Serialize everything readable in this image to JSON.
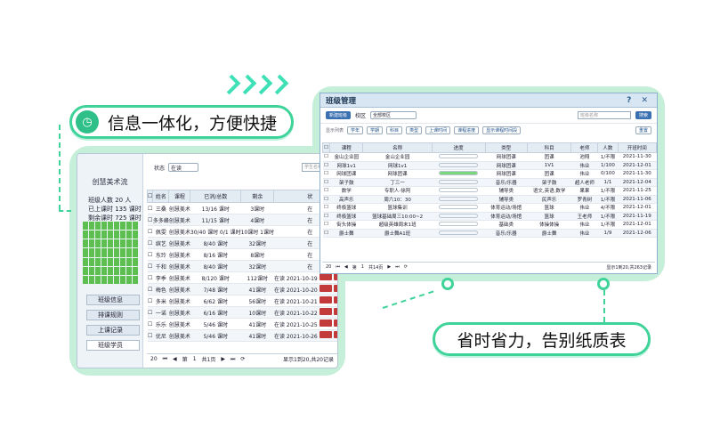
{
  "callouts": {
    "top": "信息一体化，方便快捷",
    "bottom": "省时省力，告别纸质表"
  },
  "colors": {
    "accent": "#3fd39a",
    "frame": "#c6efd9",
    "progress": "#79d77c"
  },
  "back_window": {
    "school": "创慧美术流",
    "stats": [
      "班级人数  20 人",
      "已上课时   135 课时",
      "剩余课时   725 课时"
    ],
    "menu": [
      "班级信息",
      "排课规则",
      "上课记录",
      "班级学员"
    ],
    "filter_label": "状态",
    "filter_value": "在读",
    "search_placeholder": "学生名称",
    "columns": [
      "姓名",
      "课程",
      "已消/总数",
      "剩余",
      "状"
    ],
    "rows": [
      {
        "name": "三桑",
        "course": "创慧美术",
        "used": "13/16 课时",
        "left": "3课时",
        "status": "在"
      },
      {
        "name": "多多峰",
        "course": "创慧美术",
        "used": "11/15 课时",
        "left": "4课时",
        "status": "在"
      },
      {
        "name": "佩雯",
        "course": "创慧美术",
        "used": "30/40 课时 0/1 课时",
        "left": "10课时 1课时",
        "status": "在"
      },
      {
        "name": "缤艺",
        "course": "创慧美术",
        "used": "8/40 课时",
        "left": "32课时",
        "status": "在"
      },
      {
        "name": "东玲",
        "course": "创慧美术",
        "used": "8/16 课时",
        "left": "8课时",
        "status": "在"
      },
      {
        "name": "千和",
        "course": "创慧美术",
        "used": "8/40 课时",
        "left": "32课时",
        "status": "在"
      },
      {
        "name": "李季",
        "course": "创慧美术",
        "used": "8/120 课时",
        "left": "112课时",
        "status": "在读",
        "date": "2021-10-19"
      },
      {
        "name": "梅色",
        "course": "创慧美术",
        "used": "7/48 课时",
        "left": "41课时",
        "status": "在读",
        "date": "2021-10-20"
      },
      {
        "name": "多米",
        "course": "创慧美术",
        "used": "6/62 课时",
        "left": "56课时",
        "status": "在读",
        "date": "2021-10-21"
      },
      {
        "name": "一诺",
        "course": "创慧美术",
        "used": "6/16 课时",
        "left": "10课时",
        "status": "在读",
        "date": "2021-10-22"
      },
      {
        "name": "乐乐",
        "course": "创慧美术",
        "used": "5/46 课时",
        "left": "41课时",
        "status": "在读",
        "date": "2021-10-25"
      },
      {
        "name": "优尼",
        "course": "创慧美术",
        "used": "5/46 课时",
        "left": "41课时",
        "status": "在读",
        "date": "2021-10-26"
      }
    ],
    "pager": {
      "size": "20",
      "page_label": "第",
      "page": "1",
      "total": "共1页",
      "summary": "显示1到20,共20记录"
    }
  },
  "front_window": {
    "title": "班级管理",
    "controls": "? ✕",
    "new_btn": "新建班级",
    "campus_label": "校区",
    "campus_value": "全部校区",
    "search_placeholder": "班级名称",
    "search_btn": "搜索",
    "tags_label": "显示列表",
    "tags": [
      "学年",
      "学期",
      "科目",
      "类型",
      "上课时间",
      "课程进度",
      "显示课程时间段"
    ],
    "reset": "重置",
    "columns": [
      "课程",
      "名称",
      "进度",
      "类型",
      "科目",
      "老师",
      "人数",
      "开班时间"
    ],
    "rows": [
      {
        "course": "金山企业园",
        "name": "金山企业园",
        "progress": 0,
        "type": "网球团课",
        "subject": "团课",
        "teacher": "池翔",
        "count": "1/不限",
        "date": "2021-11-30"
      },
      {
        "course": "网球1v1",
        "name": "网球1v1",
        "progress": 0,
        "type": "网球团课",
        "subject": "1V1",
        "teacher": "伟业",
        "count": "1/100",
        "date": "2021-12-01"
      },
      {
        "course": "网球团课",
        "name": "网球团课",
        "progress": 100,
        "type": "网球团课",
        "subject": "团课",
        "teacher": "伟业",
        "count": "0/100",
        "date": "2021-11-30"
      },
      {
        "course": "架子鼓",
        "name": "丁三一",
        "progress": 0,
        "type": "音乐/乐器",
        "subject": "架子鼓",
        "teacher": "超人老师",
        "count": "1/1",
        "date": "2021-12-04"
      },
      {
        "course": "数学",
        "name": "专职人-徐阿",
        "progress": 0,
        "type": "辅导类",
        "subject": "语文,英语,数学",
        "teacher": "果果",
        "count": "1/不限",
        "date": "2021-11-25"
      },
      {
        "course": "高声乐",
        "name": "周六10：30",
        "progress": 0,
        "type": "辅导类",
        "subject": "民声乐",
        "teacher": "罗青树",
        "count": "1/不限",
        "date": "2021-11-06"
      },
      {
        "course": "终极篮球",
        "name": "篮球集训",
        "progress": 0,
        "type": "体育运动/场馆",
        "subject": "篮球",
        "teacher": "伟业",
        "count": "4/不限",
        "date": "2021-12-01"
      },
      {
        "course": "终极篮球",
        "name": "篮球基础周三10:00~2",
        "progress": 0,
        "type": "体育运动/场馆",
        "subject": "篮球",
        "teacher": "王老师",
        "count": "1/不限",
        "date": "2021-11-19"
      },
      {
        "course": "街头体操",
        "name": "超级英雄周末1班",
        "progress": 0,
        "type": "基础类",
        "subject": "体操体操",
        "teacher": "伟业",
        "count": "1/不限",
        "date": "2021-12-01"
      },
      {
        "course": "爵士舞",
        "name": "爵士舞A1班",
        "progress": 0,
        "type": "音乐/乐器",
        "subject": "爵士舞",
        "teacher": "伟业",
        "count": "1/9",
        "date": "2021-12-06"
      }
    ],
    "pager": {
      "size": "20",
      "page_label": "第",
      "page": "1",
      "total": "共14页",
      "summary": "显示1到20,共263记录"
    }
  }
}
